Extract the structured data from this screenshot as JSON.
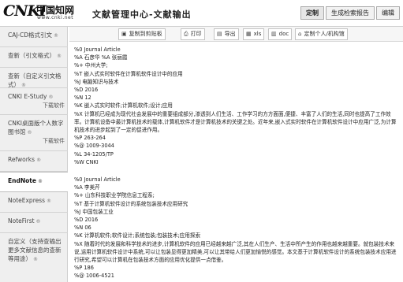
{
  "header": {
    "logo_mark": "CNKI",
    "logo_cn": "中国知网",
    "logo_url": "www.cnki.net",
    "title": "文献管理中心-文献输出",
    "tabs": [
      "定制",
      "生成检索报告",
      "编辑"
    ]
  },
  "sidebar": {
    "items": [
      {
        "label": "CAJ-CD格式引文",
        "sub": ""
      },
      {
        "label": "查新（引文格式）",
        "sub": ""
      },
      {
        "label": "查新（自定义引文格式）",
        "sub": ""
      },
      {
        "label": "CNKI E-Study",
        "sub": "下载软件"
      },
      {
        "label": "CNKI桌面版个人数字图书馆",
        "sub": "下载软件"
      },
      {
        "label": "Refworks",
        "sub": ""
      },
      {
        "label": "EndNote",
        "sub": ""
      },
      {
        "label": "NoteExpress",
        "sub": ""
      },
      {
        "label": "NoteFirst",
        "sub": ""
      },
      {
        "label": "自定义（支持查输出更多文献信息的查新等用途）",
        "sub": ""
      }
    ]
  },
  "toolbar": {
    "copy": "复制到剪贴板",
    "print": "打印",
    "export": "导出",
    "xls": "xls",
    "doc": "doc",
    "custom": "定制个人/机构馆"
  },
  "records": [
    {
      "lines": [
        {
          "tag": "%0",
          "val": "Journal Article"
        },
        {
          "tag": "%A",
          "val": "石彦华  %A 张丽霞"
        },
        {
          "tag": "%+",
          "val": "中州大学;"
        },
        {
          "tag": "%T",
          "val": "嵌入式实时软件在计算机软件设计中的应用"
        },
        {
          "tag": "%J",
          "val": "电脑知识与技术"
        },
        {
          "tag": "%D",
          "val": "2016"
        },
        {
          "tag": "%N",
          "val": "12"
        },
        {
          "tag": "%K",
          "val": "嵌入式实时软件;计算机软件;设计;应用"
        },
        {
          "tag": "%X",
          "val": "计算机已经成为现代社会发展中的重要组成部分,渗透到人们生活、工作学习的方方面面,便捷、丰富了人们的生活,同时也提高了工作效率。计算机设备中最计算机技术的载体,计算机软件才是计算机技术的关键之处。近年来,嵌入式实时软件在计算机软件设计中应用广泛,为计算机技术的进步起到了一定的促进作用。"
        },
        {
          "tag": "%P",
          "val": "263-264"
        },
        {
          "tag": "%@",
          "val": "1009-3044"
        },
        {
          "tag": "%L",
          "val": "34-1205/TP"
        },
        {
          "tag": "%W",
          "val": "CNKI"
        }
      ]
    },
    {
      "lines": [
        {
          "tag": "%0",
          "val": "Journal Article"
        },
        {
          "tag": "%A",
          "val": "李美芹"
        },
        {
          "tag": "%+",
          "val": "山东科技职业学院信息工程系;"
        },
        {
          "tag": "%T",
          "val": "基于计算机软件设计的系统包装技术应用研究"
        },
        {
          "tag": "%J",
          "val": "中国包装工业"
        },
        {
          "tag": "%D",
          "val": "2016"
        },
        {
          "tag": "%N",
          "val": "06"
        },
        {
          "tag": "%K",
          "val": "计算机软件;软件设计;系统包装;包装技术;应用探索"
        },
        {
          "tag": "%X",
          "val": "随着时代的发展和科学技术的进步,计算机软件的应用已经越来越广泛,其在人们生产、生活中所产生的作用也越来越重要。就包装技术来说,运用计算机软件设计中系统,可以让包装显得更加精美,可以让其带给人们更加愉悦的感觉。本文基于计算机软件设计的系统包装技术应用进行研究,希望可以计算机在包装技术方面的应用优化提供一点借鉴。"
        },
        {
          "tag": "%P",
          "val": "186"
        },
        {
          "tag": "%@",
          "val": "1006-4521"
        }
      ]
    }
  ]
}
